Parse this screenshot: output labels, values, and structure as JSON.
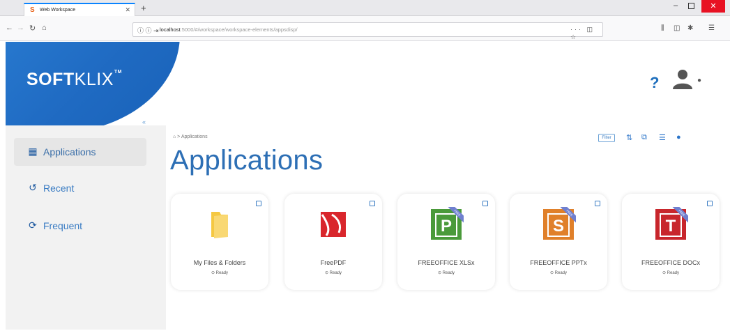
{
  "browser": {
    "tab_title": "Web Workspace",
    "tab_favicon": "S",
    "url_host": "localhost",
    "url_rest": ":5000/#/workspace/workspace-elements/appsdisp/"
  },
  "app": {
    "logo_bold": "SOFT",
    "logo_thin": "KLIX",
    "logo_tm": "TM",
    "help_label": "?",
    "brand_color": "#1f6ac2"
  },
  "sidebar": {
    "items": [
      {
        "label": "Applications",
        "icon": "grid-icon",
        "active": true
      },
      {
        "label": "Recent",
        "icon": "history-icon",
        "active": false
      },
      {
        "label": "Frequent",
        "icon": "refresh-icon",
        "active": false
      }
    ]
  },
  "main": {
    "breadcrumb": "Applications",
    "title": "Applications",
    "filter_label": "Filter"
  },
  "apps": [
    {
      "name": "My Files & Folders",
      "status": "Ready",
      "icon": "folder-icon"
    },
    {
      "name": "FreePDF",
      "status": "Ready",
      "icon": "freepdf-icon"
    },
    {
      "name": "FREEOFFICE XLSx",
      "status": "Ready",
      "icon": "planmaker-icon",
      "letter": "P",
      "color": "#4a9a3a",
      "ribbon": "FREE"
    },
    {
      "name": "FREEOFFICE PPTx",
      "status": "Ready",
      "icon": "presentations-icon",
      "letter": "S",
      "color": "#e0802a",
      "ribbon": "FREE"
    },
    {
      "name": "FREEOFFICE DOCx",
      "status": "Ready",
      "icon": "textmaker-icon",
      "letter": "T",
      "color": "#c8262c",
      "ribbon": "FREE"
    }
  ]
}
